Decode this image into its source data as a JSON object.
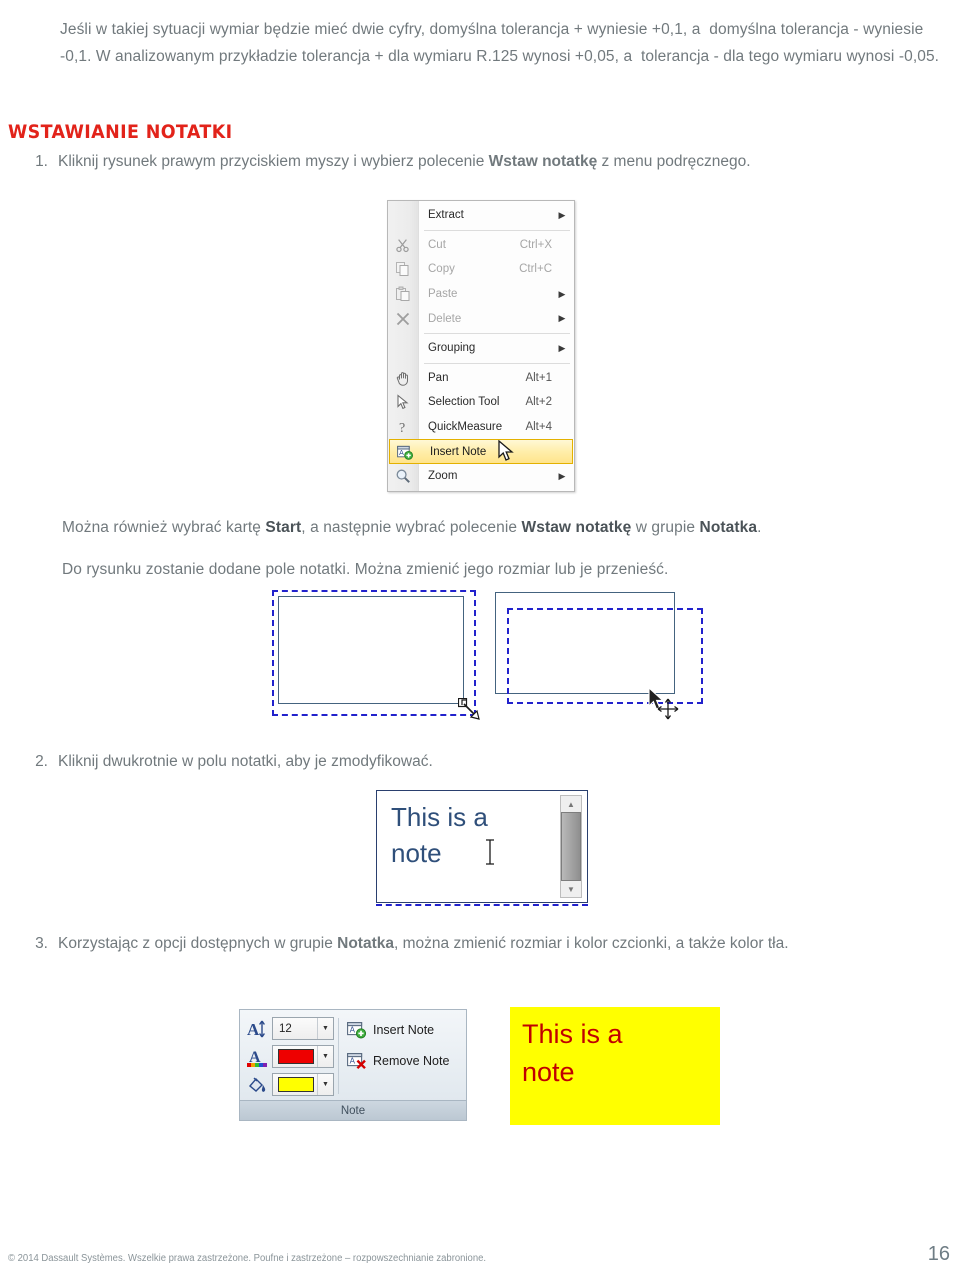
{
  "document": {
    "intro_paragraph_html": "Jeśli w takiej sytuacji wymiar będzie mieć dwie cyfry, domyślna tolerancja + wyniesie +0,1, a&nbsp; domyślna tolerancja - wyniesie -0,1. W analizowanym przykładzie tolerancja + dla wymiaru R.125 wynosi +0,05, a&nbsp; tolerancja - dla tego wymiaru wynosi -0,05.",
    "section_heading": "WSTAWIANIE NOTATKI",
    "items": [
      {
        "number": "1.",
        "text_html": "Kliknij rysunek prawym przyciskiem myszy i wybierz polecenie <b>Wstaw notatkę</b> z menu podręcznego."
      },
      {
        "number": "2.",
        "text_html": "Kliknij dwukrotnie w polu notatki, aby je zmodyfikować."
      },
      {
        "number": "3.",
        "text_html": "Korzystając z opcji dostępnych w grupie <b>Notatka</b>, można zmienić rozmiar i kolor czcionki, a także kolor tła."
      }
    ],
    "alt_paragraph_html": "Można również wybrać kartę <b>Start</b>, a następnie wybrać polecenie <b>Wstaw notatkę</b> w grupie <b>Notatka</b>.",
    "added_paragraph_html": "Do rysunku zostanie dodane pole notatki. Można zmienić jego rozmiar lub je przenieść."
  },
  "context_menu": {
    "items": [
      {
        "label": "Extract",
        "accel": "",
        "arrow": true,
        "disabled": false,
        "icon": "none",
        "highlight": false
      },
      {
        "label": "Cut",
        "accel": "Ctrl+X",
        "arrow": false,
        "disabled": true,
        "icon": "scissors-icon",
        "highlight": false
      },
      {
        "label": "Copy",
        "accel": "Ctrl+C",
        "arrow": false,
        "disabled": true,
        "icon": "copy-icon",
        "highlight": false
      },
      {
        "label": "Paste",
        "accel": "",
        "arrow": true,
        "disabled": true,
        "icon": "paste-icon",
        "highlight": false
      },
      {
        "label": "Delete",
        "accel": "",
        "arrow": true,
        "disabled": true,
        "icon": "delete-x-icon",
        "highlight": false
      },
      {
        "label": "Grouping",
        "accel": "",
        "arrow": true,
        "disabled": false,
        "icon": "none",
        "highlight": false
      },
      {
        "label": "Pan",
        "accel": "Alt+1",
        "arrow": false,
        "disabled": false,
        "icon": "hand-icon",
        "highlight": false
      },
      {
        "label": "Selection Tool",
        "accel": "Alt+2",
        "arrow": false,
        "disabled": false,
        "icon": "cursor-icon",
        "highlight": false
      },
      {
        "label": "QuickMeasure",
        "accel": "Alt+4",
        "arrow": false,
        "disabled": false,
        "icon": "measure-icon",
        "highlight": false
      },
      {
        "label": "Insert Note",
        "accel": "",
        "arrow": false,
        "disabled": false,
        "icon": "insert-note-icon",
        "highlight": true
      },
      {
        "label": "Zoom",
        "accel": "",
        "arrow": true,
        "disabled": false,
        "icon": "magnifier-icon",
        "highlight": false
      }
    ],
    "arrow_glyph": "▶",
    "separators_after": [
      0,
      4,
      5
    ]
  },
  "note_edit": {
    "line1": "This is a",
    "line2": "note"
  },
  "ribbon_panel": {
    "title": "Note",
    "font_size_value": "12",
    "font_color_hex": "#ee0000",
    "fill_color_hex": "#ffff00",
    "dropdown_glyph": "▼",
    "buttons": [
      {
        "label": "Insert Note",
        "icon": "insert-note-icon"
      },
      {
        "label": "Remove Note",
        "icon": "remove-note-icon"
      }
    ],
    "icons": {
      "font_size": "font-size-icon",
      "font_color": "font-color-icon",
      "fill_color": "fill-color-icon"
    }
  },
  "note_result": {
    "line1": "This is a",
    "line2": "note",
    "background_hex": "#ffff00",
    "text_hex": "#c00000"
  },
  "footer": {
    "copyright": "© 2014 Dassault Systèmes. Wszelkie prawa zastrzeżone. Poufne i zastrzeżone – rozpowszechnianie zabronione.",
    "page_number": "16"
  },
  "colors": {
    "heading_red": "#e2231a",
    "body_gray": "#71797d",
    "note_blue": "#2222cc",
    "solid_box_blue": "#44637f"
  }
}
